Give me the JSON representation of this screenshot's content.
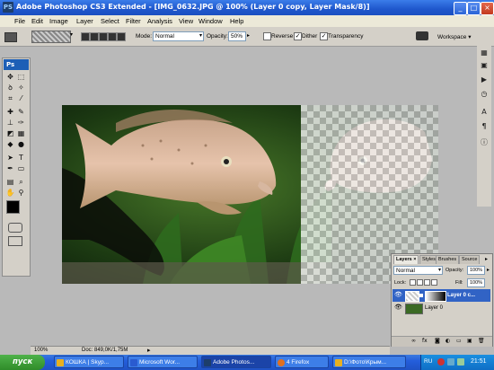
{
  "window": {
    "app_icon": "PS",
    "title": "Adobe Photoshop CS3 Extended - [IMG_0632.JPG @ 100% (Layer 0 copy, Layer Mask/8)]",
    "controls": [
      "minimize-icon",
      "maximize-icon",
      "close-icon"
    ]
  },
  "menu": [
    "File",
    "Edit",
    "Image",
    "Layer",
    "Select",
    "Filter",
    "Analysis",
    "View",
    "Window",
    "Help"
  ],
  "options": {
    "mode_label": "Mode:",
    "mode_value": "Normal",
    "opacity_label": "Opacity:",
    "opacity_value": "50%",
    "reverse_label": "Reverse",
    "reverse_checked": false,
    "dither_label": "Dither",
    "dither_checked": true,
    "transparency_label": "Transparency",
    "transparency_checked": true,
    "workspace_label": "Workspace ▾"
  },
  "toolbox": {
    "logo": "Ps"
  },
  "layers": {
    "tabs": [
      "Layers ×",
      "Styles",
      "Brushes",
      "Source"
    ],
    "blend_mode": "Normal",
    "opacity_label": "Opacity:",
    "opacity_value": "100%",
    "lock_label": "Lock:",
    "fill_label": "Fill:",
    "fill_value": "100%",
    "rows": [
      {
        "name": "Layer 0 c...",
        "selected": true
      },
      {
        "name": "Layer 0",
        "selected": false
      }
    ]
  },
  "status": {
    "zoom": "100%",
    "doc": "Doc: 849,0K/1,75M"
  },
  "taskbar": {
    "start": "пуск",
    "tasks": [
      {
        "label": "КОШКА | Skyp...",
        "active": false
      },
      {
        "label": "Microsoft Wor...",
        "active": false
      },
      {
        "label": "Adobe Photos...",
        "active": true
      },
      {
        "label": "4 Firefox",
        "active": false
      },
      {
        "label": "D:\\Фото\\Крым...",
        "active": false
      }
    ],
    "lang": "RU",
    "time": "21:51"
  },
  "colors": {
    "accent": "#245edb",
    "selected_layer": "#3163c5"
  }
}
